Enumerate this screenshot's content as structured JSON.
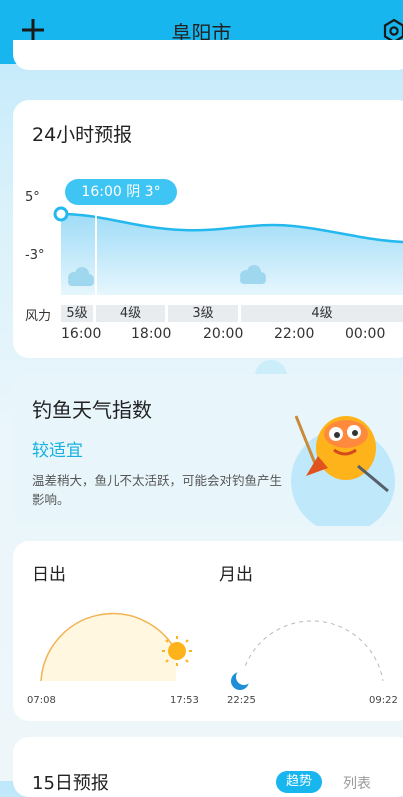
{
  "header": {
    "city": "阜阳市",
    "page_count": 3,
    "active_page": 3,
    "background_color": "#17b6ee",
    "icons": [
      "plus-icon",
      "settings-icon"
    ]
  },
  "hourly": {
    "title": "24小时预报",
    "tag": "16:00 阴 3°",
    "temp_high_label": "5°",
    "temp_low_label": "-3°",
    "wind_label": "风力",
    "wind_levels": [
      "5级",
      "4级",
      "3级",
      "4级"
    ],
    "times": [
      "16:00",
      "18:00",
      "20:00",
      "22:00",
      "00:00"
    ],
    "weather_icons": [
      "cloud-icon",
      "cloud-icon"
    ]
  },
  "fishing": {
    "title": "钓鱼天气指数",
    "level": "较适宜",
    "description": "温差稍大，鱼儿不太活跃，可能会对钓鱼产生影响。",
    "icon": "fish-mascot-icon"
  },
  "sun_moon": {
    "sunrise_title": "日出",
    "moonrise_title": "月出",
    "sunrise_time": "07:08",
    "sunset_time": "17:53",
    "moonrise_time": "22:25",
    "moonset_time": "09:22"
  },
  "forecast15": {
    "title": "15日预报",
    "tab_trend": "趋势",
    "tab_list": "列表"
  }
}
